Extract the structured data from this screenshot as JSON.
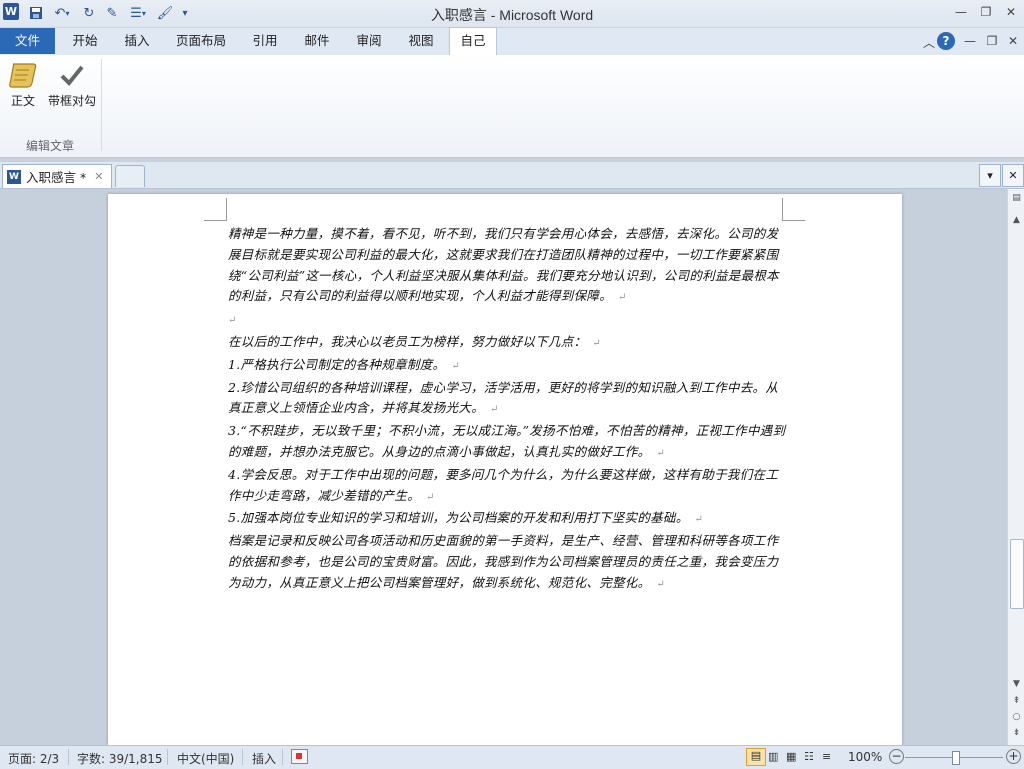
{
  "app": {
    "window_title": "入职感言 - Microsoft Word"
  },
  "quick_access": {
    "icons": [
      "word-logo-icon",
      "save-icon",
      "undo-icon",
      "redo-icon",
      "edit-icon",
      "layout-icon",
      "format-painter-icon",
      "customize-icon"
    ]
  },
  "ribbon_tabs": [
    "文件",
    "开始",
    "插入",
    "页面布局",
    "引用",
    "邮件",
    "审阅",
    "视图",
    "自己"
  ],
  "ribbon": {
    "buttons": [
      {
        "label": "正文",
        "icon": "scroll-icon"
      },
      {
        "label": "带框对勾",
        "icon": "checkmark-icon"
      }
    ],
    "group_label": "编辑文章"
  },
  "document_tab": {
    "label": "入职感言 *"
  },
  "document": {
    "paragraphs": [
      "精神是一种力量，摸不着，看不见，听不到，我们只有学会用心体会，去感悟，去深化。公司的发展目标就是要实现公司利益的最大化，这就要求我们在打造团队精神的过程中，一切工作要紧紧围绕“公司利益”这一核心，个人利益坚决服从集体利益。我们要充分地认识到，公司的利益是最根本的利益，只有公司的利益得以顺利地实现，个人利益才能得到保障。",
      "",
      "在以后的工作中，我决心以老员工为榜样，努力做好以下几点：",
      "1.严格执行公司制定的各种规章制度。",
      "2.珍惜公司组织的各种培训课程，虚心学习，活学活用，更好的将学到的知识融入到工作中去。从真正意义上领悟企业内含，并将其发扬光大。",
      "3.“不积跬步，无以致千里；不积小流，无以成江海。”发扬不怕难，不怕苦的精神，正视工作中遇到的难题，并想办法克服它。从身边的点滴小事做起，认真扎实的做好工作。",
      "4.学会反思。对于工作中出现的问题，要多问几个为什么，为什么要这样做，这样有助于我们在工作中少走弯路，减少差错的产生。",
      "5.加强本岗位专业知识的学习和培训，为公司档案的开发和利用打下坚实的基础。",
      "档案是记录和反映公司各项活动和历史面貌的第一手资料，是生产、经营、管理和科研等各项工作的依据和参考，也是公司的宝贵财富。因此，我感到作为公司档案管理员的责任之重，我会变压力为动力，从真正意义上把公司档案管理好，做到系统化、规范化、完整化。"
    ],
    "paragraph_mark": "↵"
  },
  "status": {
    "page": "页面: 2/3",
    "words": "字数: 39/1,815",
    "language": "中文(中国)",
    "mode": "插入",
    "zoom": "100%",
    "zoom_minus": "−",
    "zoom_plus": "+"
  }
}
